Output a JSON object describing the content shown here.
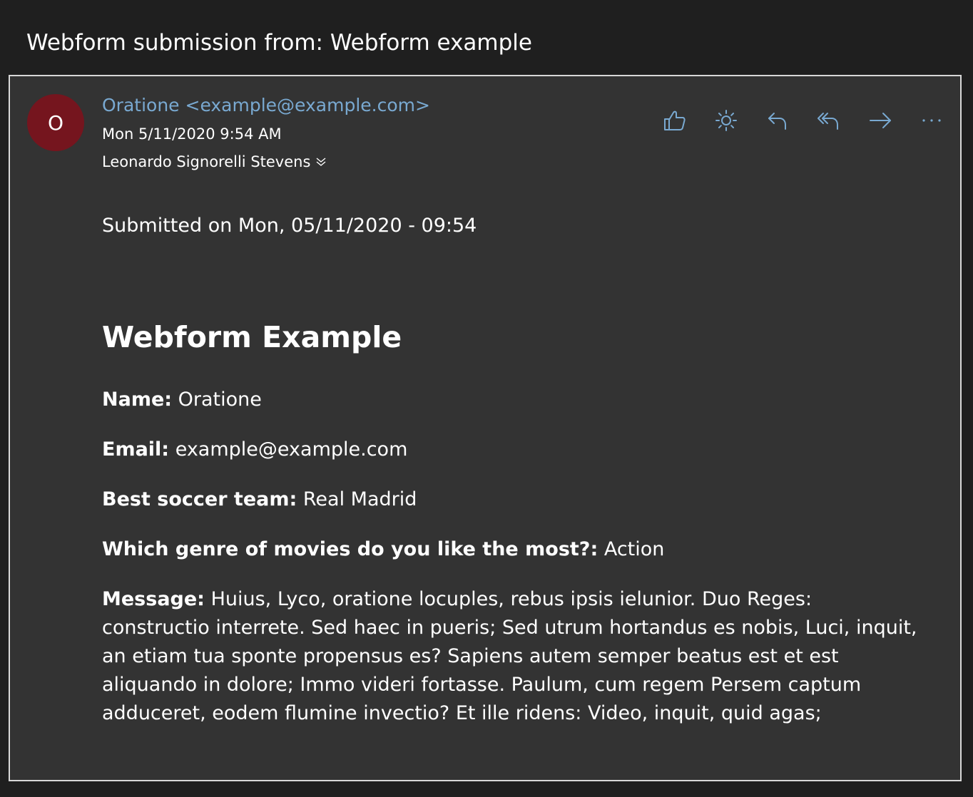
{
  "subject": "Webform submission from: Webform example",
  "sender": {
    "avatar_initial": "O",
    "avatar_color": "#75151e",
    "name_email": "Oratione <example@example.com>",
    "date": "Mon 5/11/2020 9:54 AM",
    "recipients": "Leonardo Signorelli Stevens"
  },
  "toolbar": {
    "like": "like-icon",
    "sun": "sun-icon",
    "reply": "reply-icon",
    "reply_all": "reply-all-icon",
    "forward": "forward-icon",
    "more": "more-icon"
  },
  "body": {
    "submitted": "Submitted on Mon, 05/11/2020 - 09:54",
    "form_title": "Webform Example",
    "fields": [
      {
        "label": "Name:",
        "value": " Oratione"
      },
      {
        "label": "Email:",
        "value": " example@example.com"
      },
      {
        "label": "Best soccer team:",
        "value": " Real Madrid"
      },
      {
        "label": "Which genre of movies do you like the most?:",
        "value": " Action"
      }
    ],
    "message_label": "Message:",
    "message_value": " Huius, Lyco, oratione locuples, rebus ipsis ielunior. Duo Reges: constructio interrete. Sed haec in pueris; Sed utrum hortandus es nobis, Luci, inquit, an etiam tua sponte propensus es? Sapiens autem semper beatus est et est aliquando in dolore; Immo videri fortasse. Paulum, cum regem Persem captum adduceret, eodem flumine invectio? Et ille ridens: Video, inquit, quid agas;"
  },
  "colors": {
    "accent": "#79a9d1",
    "card_bg": "#333333",
    "page_bg": "#1f1f1f"
  }
}
